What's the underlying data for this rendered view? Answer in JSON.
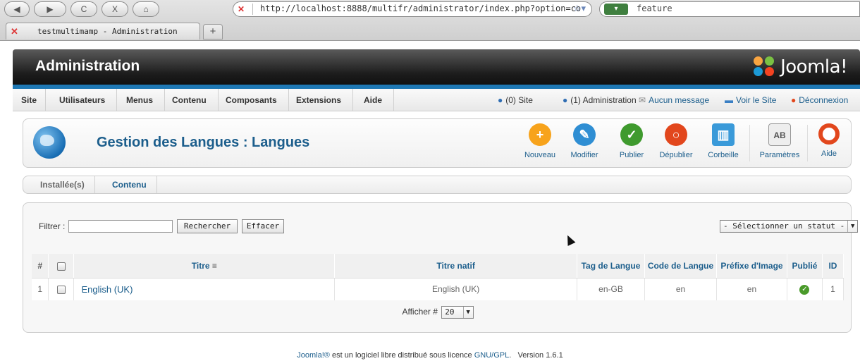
{
  "browser": {
    "url": "http://localhost:8888/multifr/administrator/index.php?option=co",
    "search_query": "feature",
    "tab_title": "testmultimamp - Administration",
    "new_tab_label": "+",
    "nav": {
      "back": "◀",
      "forward": "▶",
      "reload": "C",
      "stop": "X",
      "home": "⌂"
    }
  },
  "header": {
    "title": "Administration",
    "logo_text": "Joomla!",
    "logo_colors": [
      "#f9a541",
      "#7ac143",
      "#1c9ad6",
      "#f44321"
    ]
  },
  "menu": {
    "items": [
      "Site",
      "Utilisateurs",
      "Menus",
      "Contenu",
      "Composants",
      "Extensions",
      "Aide"
    ],
    "status": {
      "site_users": "(0) Site",
      "admin_users": "(1) Administration",
      "messages": "Aucun message",
      "view_site": "Voir le Site",
      "logout": "Déconnexion"
    }
  },
  "toolbar": {
    "page_title": "Gestion des Langues : Langues",
    "buttons": {
      "new": {
        "label": "Nouveau",
        "icon": "plus-icon",
        "color": "#f7a31c"
      },
      "edit": {
        "label": "Modifier",
        "icon": "pencil-icon",
        "color": "#2f8ed3"
      },
      "publish": {
        "label": "Publier",
        "icon": "check-icon",
        "color": "#3f9a2e"
      },
      "unpublish": {
        "label": "Dépublier",
        "icon": "unpublish-icon",
        "color": "#e2471d"
      },
      "trash": {
        "label": "Corbeille",
        "icon": "trash-icon",
        "color": "#3a9ad9"
      },
      "params": {
        "label": "Paramètres",
        "icon": "params-icon",
        "color": "#888888"
      },
      "help": {
        "label": "Aide",
        "icon": "lifebuoy-icon",
        "color": "#e2471d"
      }
    }
  },
  "subtabs": {
    "installed": "Installée(s)",
    "content": "Contenu"
  },
  "filter": {
    "label": "Filtrer :",
    "value": "",
    "search_button": "Rechercher",
    "clear_button": "Effacer",
    "status_select": "- Sélectionner un statut -"
  },
  "table": {
    "headers": {
      "num": "#",
      "title": "Titre",
      "native_title": "Titre natif",
      "lang_tag": "Tag de Langue",
      "lang_code": "Code de Langue",
      "image_prefix": "Préfixe d'Image",
      "published": "Publié",
      "id": "ID"
    },
    "rows": [
      {
        "num": "1",
        "title": "English (UK)",
        "native_title": "English (UK)",
        "lang_tag": "en-GB",
        "lang_code": "en",
        "image_prefix": "en",
        "published": true,
        "id": "1"
      }
    ]
  },
  "pagination": {
    "label": "Afficher #",
    "value": "20"
  },
  "footer": {
    "brand": "Joomla!®",
    "text": " est un logiciel libre distribué sous licence ",
    "license": "GNU/GPL",
    "version": "Version 1.6.1"
  }
}
